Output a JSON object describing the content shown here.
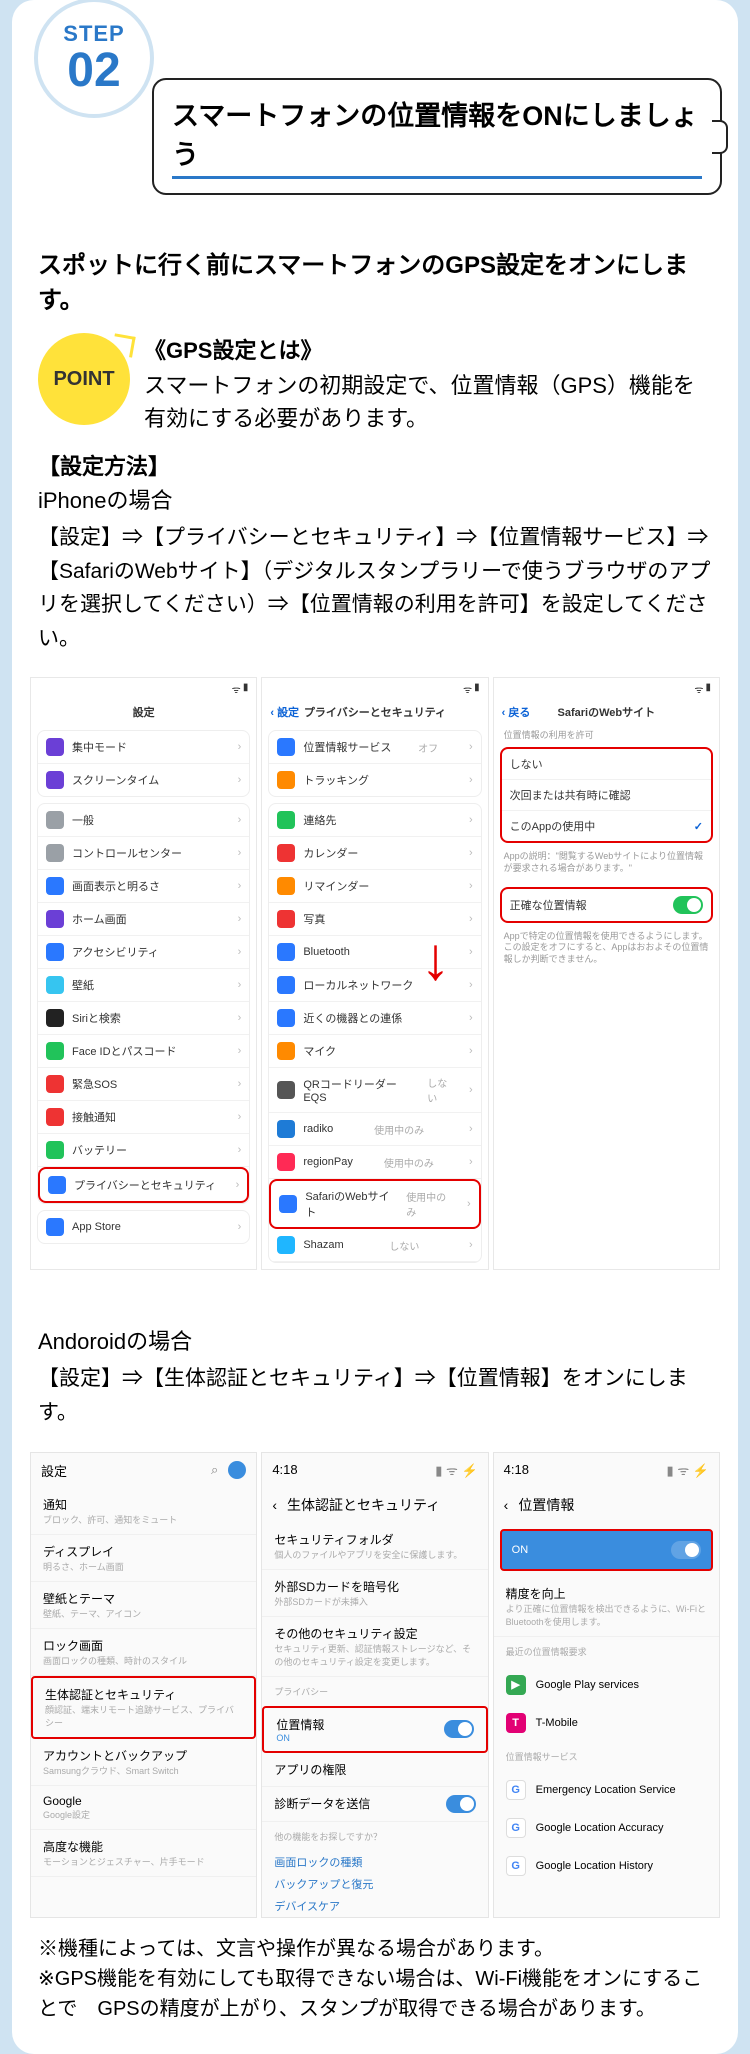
{
  "step": {
    "word": "STEP",
    "num": "02"
  },
  "title": "スマートフォンの位置情報をONにしましょう",
  "lead": "スポットに行く前にスマートフォンのGPS設定をオンにします。",
  "point": {
    "badge": "POINT",
    "heading": "《GPS設定とは》",
    "desc": "スマートフォンの初期設定で、位置情報（GPS）機能を有効にする必要があります。"
  },
  "howto_heading": "【設定方法】",
  "iphone": {
    "label": "iPhoneの場合",
    "flow": "【設定】⇒【プライバシーとセキュリティ】⇒【位置情報サービス】⇒【SafariのWebサイト】（デジタルスタンプラリーで使うブラウザのアプリを選択してください）⇒【位置情報の利用を許可】を設定してください。",
    "s1": {
      "title": "設定",
      "g1": [
        {
          "ic": "#6b3fd6",
          "t": "集中モード"
        },
        {
          "ic": "#6b3fd6",
          "t": "スクリーンタイム"
        }
      ],
      "g2": [
        {
          "ic": "#9aa0a6",
          "t": "一般"
        },
        {
          "ic": "#9aa0a6",
          "t": "コントロールセンター"
        },
        {
          "ic": "#2a78ff",
          "t": "画面表示と明るさ"
        },
        {
          "ic": "#6b3fd6",
          "t": "ホーム画面"
        },
        {
          "ic": "#2a78ff",
          "t": "アクセシビリティ"
        },
        {
          "ic": "#36c5f0",
          "t": "壁紙"
        },
        {
          "ic": "#222",
          "t": "Siriと検索"
        },
        {
          "ic": "#21c35a",
          "t": "Face IDとパスコード"
        },
        {
          "ic": "#e33",
          "t": "緊急SOS"
        },
        {
          "ic": "#e33",
          "t": "接触通知"
        },
        {
          "ic": "#21c35a",
          "t": "バッテリー"
        },
        {
          "ic": "#2a78ff",
          "t": "プライバシーとセキュリティ",
          "hl": true
        }
      ],
      "g3": [
        {
          "ic": "#2a78ff",
          "t": "App Store"
        }
      ]
    },
    "s2": {
      "back": "設定",
      "title": "プライバシーとセキュリティ",
      "g1": [
        {
          "ic": "#2a78ff",
          "t": "位置情報サービス",
          "v": "オフ"
        },
        {
          "ic": "#ff8a00",
          "t": "トラッキング"
        }
      ],
      "g2": [
        {
          "ic": "#21c35a",
          "t": "連絡先"
        },
        {
          "ic": "#e33",
          "t": "カレンダー"
        },
        {
          "ic": "#ff8a00",
          "t": "リマインダー"
        },
        {
          "ic": "#e33",
          "t": "写真"
        },
        {
          "ic": "#2a78ff",
          "t": "Bluetooth"
        },
        {
          "ic": "#2a78ff",
          "t": "ローカルネットワーク"
        },
        {
          "ic": "#2a78ff",
          "t": "近くの機器との連係"
        },
        {
          "ic": "#ff8a00",
          "t": "マイク"
        },
        {
          "ic": "#555",
          "t": "QRコードリーダーEQS",
          "v": "しない"
        },
        {
          "ic": "#1e7bd6",
          "t": "radiko",
          "v": "使用中のみ"
        },
        {
          "ic": "#ff2a55",
          "t": "regionPay",
          "v": "使用中のみ"
        },
        {
          "ic": "#2a78ff",
          "t": "SafariのWebサイト",
          "v": "使用中のみ",
          "hl": true
        },
        {
          "ic": "#1fb6ff",
          "t": "Shazam",
          "v": "しない"
        }
      ]
    },
    "s3": {
      "back": "戻る",
      "title": "SafariのWebサイト",
      "cap": "位置情報の利用を許可",
      "opts": [
        {
          "t": "しない"
        },
        {
          "t": "次回または共有時に確認"
        },
        {
          "t": "このAppの使用中",
          "sel": true
        }
      ],
      "note1": "Appの説明：\"閲覧するWebサイトにより位置情報が要求される場合があります。\"",
      "precise": "正確な位置情報",
      "note2": "Appで特定の位置情報を使用できるようにします。この設定をオフにすると、Appはおおよその位置情報しか判断できません。"
    }
  },
  "android": {
    "label": "Andoroidの場合",
    "flow": "【設定】⇒【生体認証とセキュリティ】⇒【位置情報】をオンにします。",
    "s1": {
      "title": "設定",
      "items": [
        {
          "t": "通知",
          "s": "ブロック、許可、通知をミュート"
        },
        {
          "t": "ディスプレイ",
          "s": "明るさ、ホーム画面"
        },
        {
          "t": "壁紙とテーマ",
          "s": "壁紙、テーマ、アイコン"
        },
        {
          "t": "ロック画面",
          "s": "画面ロックの種類、時計のスタイル"
        },
        {
          "t": "生体認証とセキュリティ",
          "s": "顔認証、端末リモート追跡サービス、プライバシー",
          "hl": true
        },
        {
          "t": "アカウントとバックアップ",
          "s": "Samsungクラウド、Smart Switch"
        },
        {
          "t": "Google",
          "s": "Google設定"
        },
        {
          "t": "高度な機能",
          "s": "モーションとジェスチャー、片手モード"
        }
      ]
    },
    "s2": {
      "time": "4:18",
      "back": "生体認証とセキュリティ",
      "items": [
        {
          "t": "セキュリティフォルダ",
          "s": "個人のファイルやアプリを安全に保護します。"
        },
        {
          "t": "外部SDカードを暗号化",
          "s": "外部SDカードが未挿入"
        },
        {
          "t": "その他のセキュリティ設定",
          "s": "セキュリティ更新、認証情報ストレージなど、その他のセキュリティ設定を変更します。"
        }
      ],
      "privacy_h": "プライバシー",
      "loc": {
        "t": "位置情報",
        "s": "ON",
        "hl": true
      },
      "items2": [
        {
          "t": "アプリの権限"
        },
        {
          "t": "診断データを送信",
          "tg": true
        }
      ],
      "more_q": "他の機能をお探しですか？",
      "links": [
        "画面ロックの種類",
        "バックアップと復元",
        "デバイスケア"
      ]
    },
    "s3": {
      "time": "4:18",
      "back": "位置情報",
      "on": "ON",
      "acc": {
        "t": "精度を向上",
        "s": "より正確に位置情報を検出できるように、Wi-FiとBluetoothを使用します。"
      },
      "recent_h": "最近の位置情報要求",
      "recent": [
        {
          "c": "#34a853",
          "l": "▶",
          "t": "Google Play services"
        },
        {
          "c": "#e20074",
          "l": "T",
          "t": "T-Mobile"
        }
      ],
      "svc_h": "位置情報サービス",
      "svc": [
        {
          "t": "Emergency Location Service"
        },
        {
          "t": "Google Location Accuracy"
        },
        {
          "t": "Google Location History"
        }
      ]
    }
  },
  "footnotes": [
    "※機種によっては、文言や操作が異なる場合があります。",
    "※GPS機能を有効にしても取得できない場合は、Wi-Fi機能をオンにすることで　GPSの精度が上がり、スタンプが取得できる場合があります。"
  ]
}
